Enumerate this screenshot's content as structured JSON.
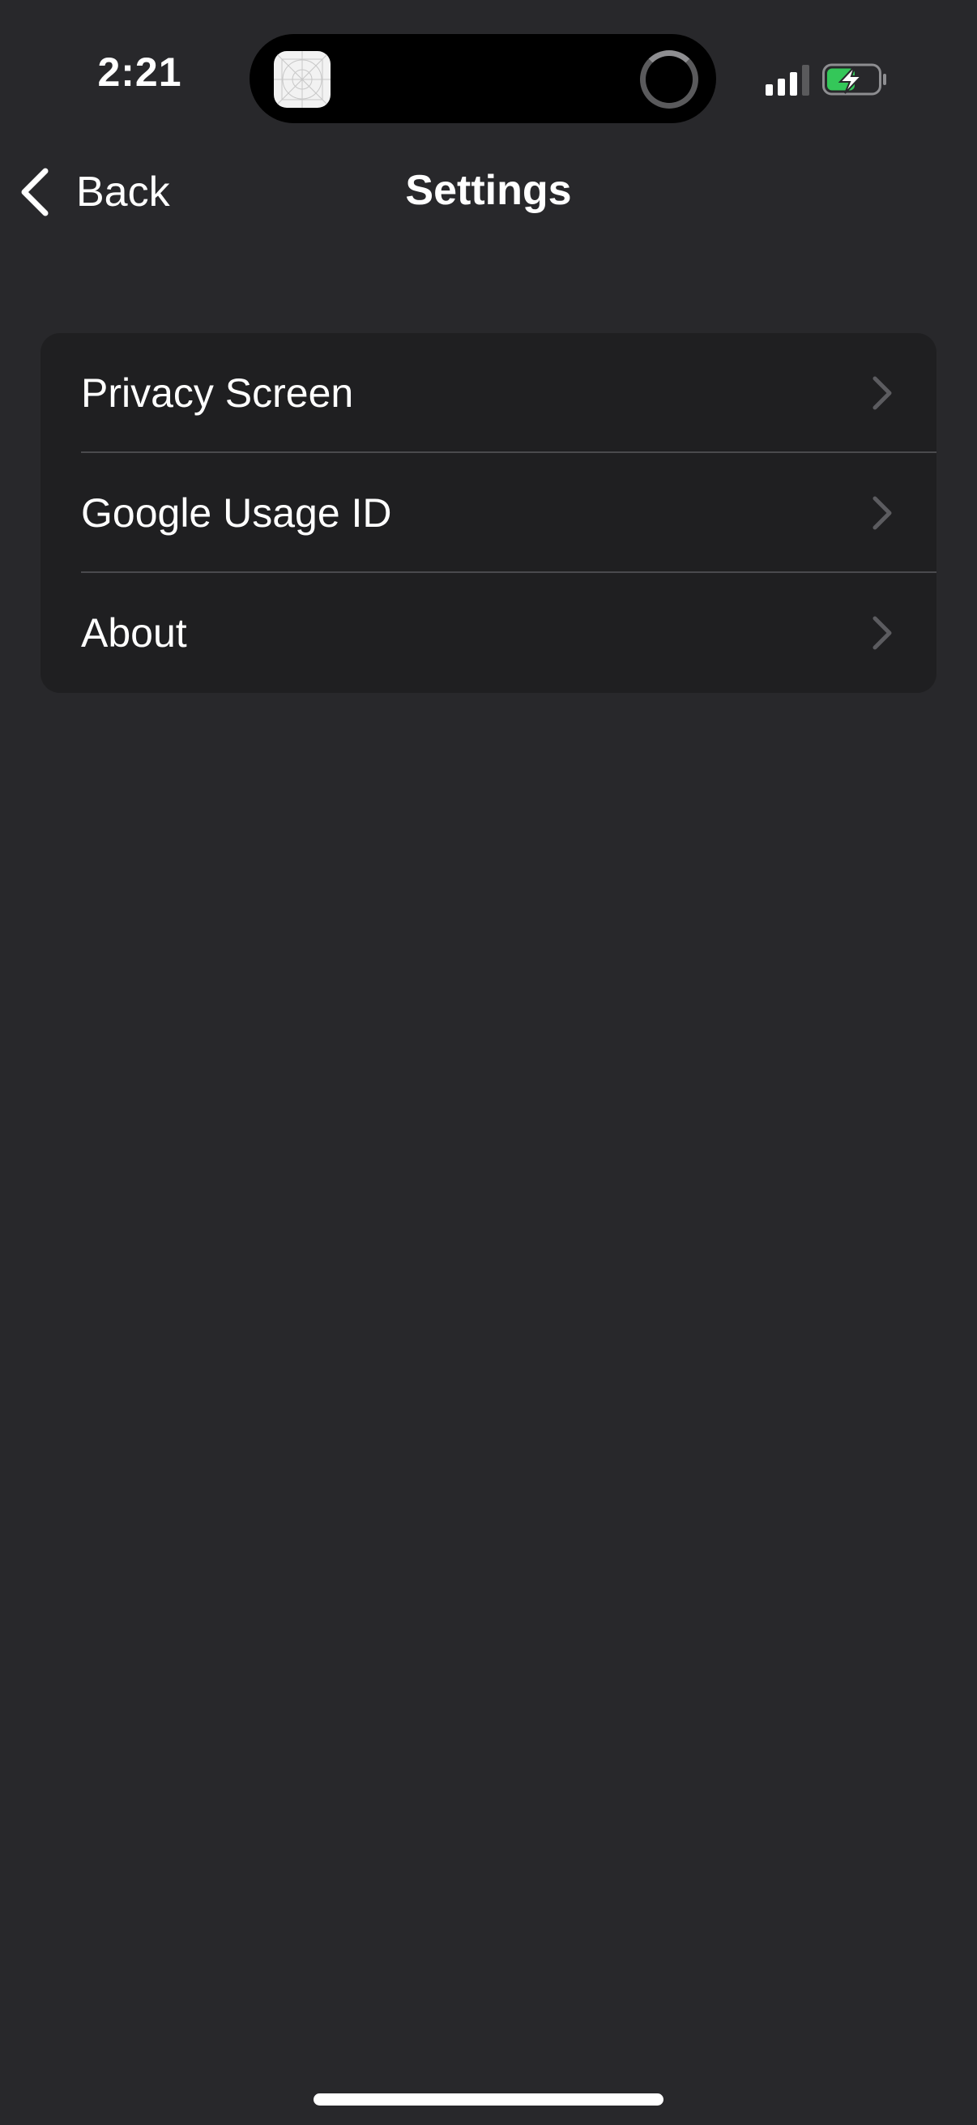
{
  "status_bar": {
    "time": "2:21",
    "battery_color": "#34c759"
  },
  "nav": {
    "back_label": "Back",
    "title": "Settings"
  },
  "settings": {
    "items": [
      {
        "label": "Privacy Screen"
      },
      {
        "label": "Google Usage ID"
      },
      {
        "label": "About"
      }
    ]
  }
}
